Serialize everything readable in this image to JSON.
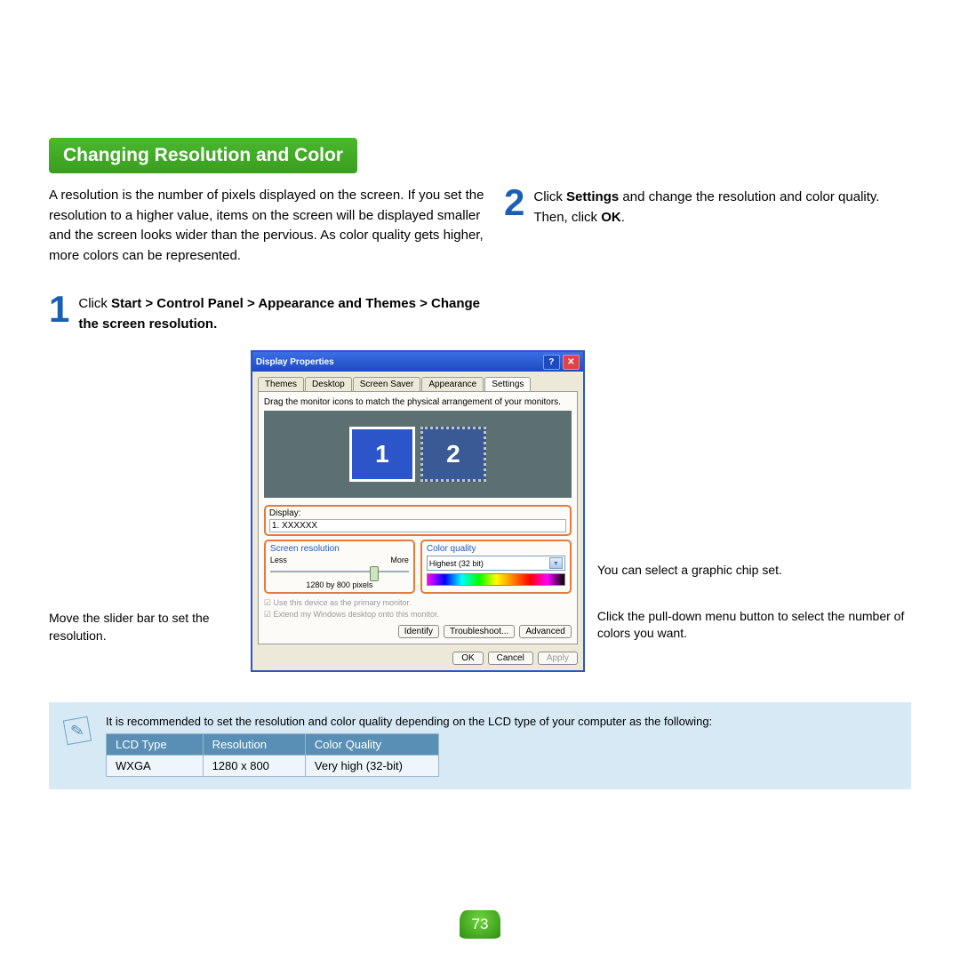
{
  "heading": "Changing Resolution and Color",
  "intro": "A resolution is the number of pixels displayed on the screen. If you set the resolution to a higher value, items on the screen will be displayed smaller and the screen looks wider than the pervious. As color quality gets higher, more colors can be represented.",
  "step1_num": "1",
  "step1_prefix": "Click ",
  "step1_bold": "Start > Control Panel > Appearance and Themes > Change the screen resolution.",
  "step2_num": "2",
  "step2_a": "Click ",
  "step2_b": "Settings",
  "step2_c": " and change the resolution and color quality. Then, click ",
  "step2_d": "OK",
  "step2_e": ".",
  "window": {
    "title": "Display Properties",
    "help": "?",
    "close": "✕",
    "tabs": {
      "themes": "Themes",
      "desktop": "Desktop",
      "saver": "Screen Saver",
      "appearance": "Appearance",
      "settings": "Settings"
    },
    "drag_text": "Drag the monitor icons to match the physical arrangement of your monitors.",
    "mon1": "1",
    "mon2": "2",
    "display_label": "Display:",
    "display_value": "1.  XXXXXX",
    "sr_title": "Screen resolution",
    "sr_less": "Less",
    "sr_more": "More",
    "sr_value": "1280 by 800 pixels",
    "cq_title": "Color quality",
    "cq_value": "Highest (32 bit)",
    "check1": "☑ Use this device as the primary monitor.",
    "check2": "☑ Extend my Windows desktop onto this monitor.",
    "btn_identify": "Identify",
    "btn_trouble": "Troubleshoot...",
    "btn_adv": "Advanced",
    "btn_ok": "OK",
    "btn_cancel": "Cancel",
    "btn_apply": "Apply"
  },
  "callouts": {
    "left": "Move the slider bar to set the resolution.",
    "right1": "You can select a graphic chip set.",
    "right2": "Click the pull-down menu button to select the number of colors you want."
  },
  "note": {
    "text": "It is recommended to set the resolution and color quality depending on the LCD type of your computer as the following:",
    "headers": {
      "lcd": "LCD Type",
      "res": "Resolution",
      "cq": "Color Quality"
    },
    "row": {
      "lcd": "WXGA",
      "res": "1280 x 800",
      "cq": "Very high (32-bit)"
    }
  },
  "page_number": "73",
  "chart_data": {
    "type": "table",
    "title": "Recommended LCD settings",
    "columns": [
      "LCD Type",
      "Resolution",
      "Color Quality"
    ],
    "rows": [
      [
        "WXGA",
        "1280 x 800",
        "Very high (32-bit)"
      ]
    ]
  }
}
